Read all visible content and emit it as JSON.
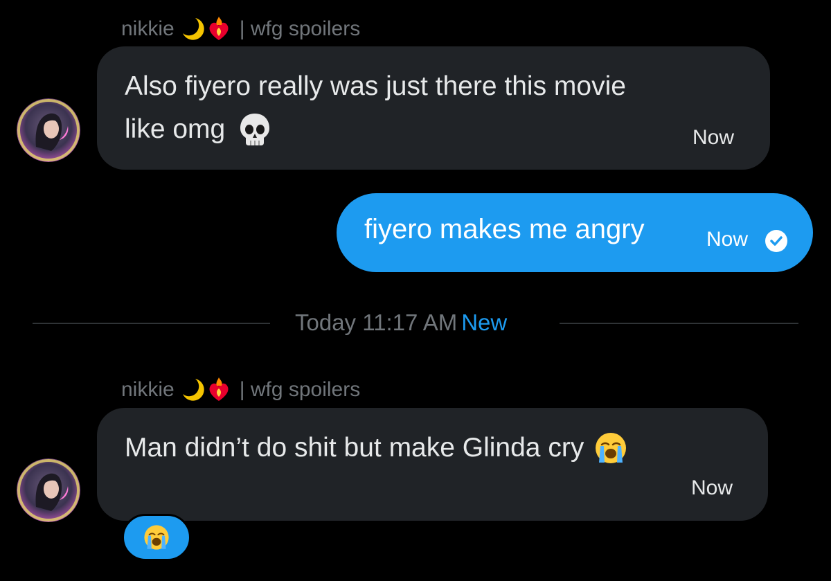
{
  "messages": [
    {
      "sender_name": "nikkie",
      "sender_emoji": "🌙❤️‍🔥",
      "sender_suffix": "| wfg spoilers",
      "line1": "Also fiyero really was just there this movie",
      "line2": "like omg",
      "emoji": "💀",
      "time": "Now"
    },
    {
      "text": "fiyero makes me angry",
      "time": "Now",
      "status_icon": "check-circle-icon"
    },
    {
      "sender_name": "nikkie",
      "sender_emoji": "🌙❤️‍🔥",
      "sender_suffix": "| wfg spoilers",
      "line1": "Man didn’t do shit but make Glinda cry",
      "emoji": "😭",
      "time": "Now",
      "reaction": "😭"
    }
  ],
  "divider": {
    "label": "Today 11:17 AM",
    "new_label": "New"
  },
  "colors": {
    "background": "#000000",
    "incoming_bubble": "#202327",
    "outgoing_bubble": "#1d9bf0",
    "muted_text": "#71767b",
    "accent": "#1d9bf0"
  }
}
